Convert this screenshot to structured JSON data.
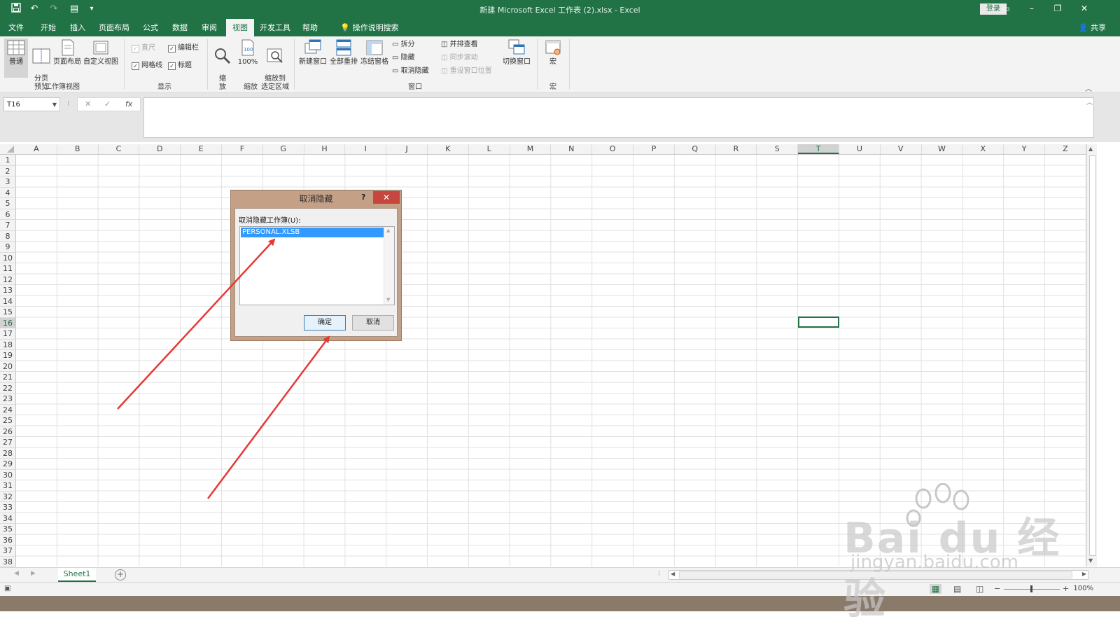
{
  "window": {
    "title": "新建 Microsoft Excel 工作表 (2).xlsx  -  Excel",
    "login_label": "登录",
    "share_label": "共享"
  },
  "tabs": [
    "文件",
    "开始",
    "插入",
    "页面布局",
    "公式",
    "数据",
    "审阅",
    "视图",
    "开发工具",
    "帮助"
  ],
  "active_tab": "视图",
  "tell_me": "操作说明搜索",
  "ribbon": {
    "workbook_views": {
      "label": "工作簿视图",
      "normal": "普通",
      "page_break": "分页\n预览",
      "page_layout": "页面布局",
      "custom_views": "自定义视图"
    },
    "show": {
      "label": "显示",
      "ruler": "直尺",
      "formula_bar": "编辑栏",
      "gridlines": "网格线",
      "headings": "标题"
    },
    "zoom": {
      "label": "缩放",
      "zoom": "缩\n放",
      "hundred": "100%",
      "zoom_selection": "缩放到\n选定区域"
    },
    "window": {
      "label": "窗口",
      "new_window": "新建窗口",
      "arrange_all": "全部重排",
      "freeze_panes": "冻结窗格",
      "split": "拆分",
      "hide": "隐藏",
      "unhide": "取消隐藏",
      "side_by_side": "并排查看",
      "sync_scroll": "同步滚动",
      "reset_position": "重设窗口位置",
      "switch_windows": "切换窗口"
    },
    "macros": {
      "label": "宏",
      "macros": "宏"
    }
  },
  "formula_bar": {
    "name_box": "T16",
    "cancel_glyph": "✕",
    "enter_glyph": "✓",
    "fx": "fx",
    "value": ""
  },
  "grid": {
    "columns": [
      "A",
      "B",
      "C",
      "D",
      "E",
      "F",
      "G",
      "H",
      "I",
      "J",
      "K",
      "L",
      "M",
      "N",
      "O",
      "P",
      "Q",
      "R",
      "S",
      "T",
      "U",
      "V",
      "W",
      "X",
      "Y",
      "Z"
    ],
    "rows": [
      "1",
      "2",
      "3",
      "4",
      "5",
      "6",
      "7",
      "8",
      "9",
      "10",
      "11",
      "12",
      "13",
      "14",
      "15",
      "16",
      "17",
      "18",
      "19",
      "20",
      "21",
      "22",
      "23",
      "24",
      "25",
      "26",
      "27",
      "28",
      "29",
      "30",
      "31",
      "32",
      "33",
      "34",
      "35",
      "36",
      "37",
      "38"
    ],
    "selected_cell": "T16"
  },
  "sheets": {
    "tab": "Sheet1",
    "add": "+"
  },
  "status": {
    "zoom": "100%"
  },
  "dialog": {
    "title": "取消隐藏",
    "help": "?",
    "close": "✕",
    "label": "取消隐藏工作簿(U):",
    "items": [
      "PERSONAL.XLSB"
    ],
    "ok": "确定",
    "cancel": "取消"
  },
  "watermark": {
    "brand": "Bai du 经验",
    "url": "jingyan.baidu.com"
  },
  "colors": {
    "accent": "#217346",
    "annotation_arrow": "#e53935",
    "selection": "#3399ff"
  }
}
